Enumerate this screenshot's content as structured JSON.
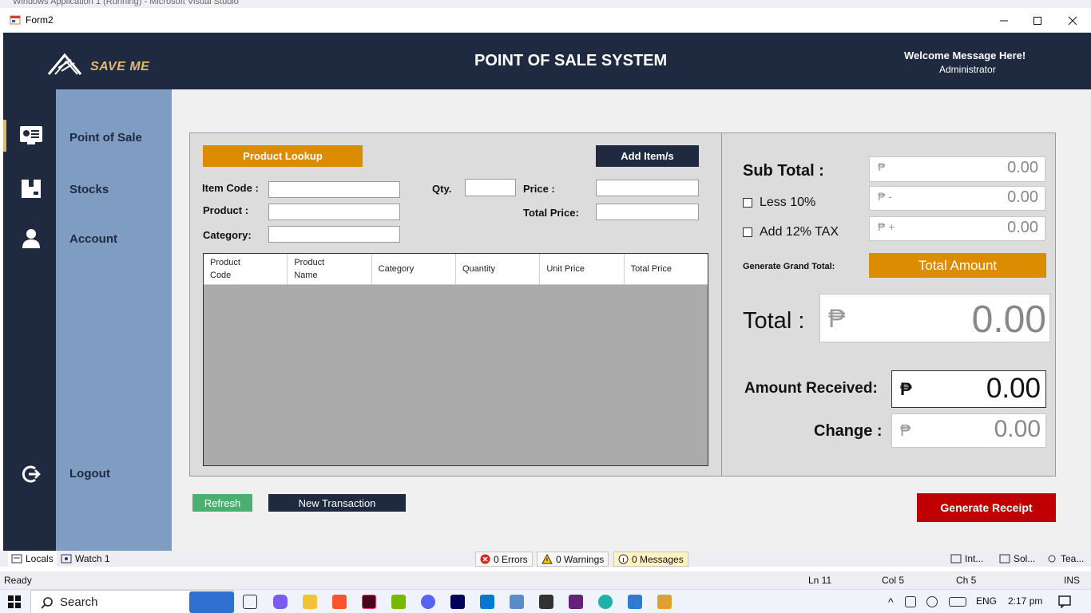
{
  "window": {
    "title": "Form2",
    "background_title": "Windows Application 1 (Running) - Microsoft Visual Studio"
  },
  "header": {
    "logo_text": "SAVE ME",
    "app_title": "POINT OF SALE SYSTEM",
    "welcome": "Welcome Message Here!",
    "role": "Administrator"
  },
  "nav": {
    "items": [
      {
        "label": "Point of Sale",
        "icon": "pos-icon"
      },
      {
        "label": "Stocks",
        "icon": "box-icon"
      },
      {
        "label": "Account",
        "icon": "user-icon"
      }
    ],
    "logout_label": "Logout"
  },
  "pos": {
    "product_lookup": "Product Lookup",
    "add_items": "Add Item/s",
    "item_code_label": "Item Code :",
    "product_label": "Product :",
    "category_label": "Category:",
    "qty_label": "Qty.",
    "price_label": "Price :",
    "total_price_label": "Total Price:",
    "columns": [
      "Product\nCode",
      "Product\nName",
      "Category",
      "Quantity",
      "Unit Price",
      "Total Price"
    ],
    "refresh": "Refresh",
    "new_transaction": "New Transaction",
    "generate_receipt": "Generate Receipt"
  },
  "totals": {
    "subtotal_label": "Sub Total :",
    "subtotal_prefix": "₱",
    "subtotal_value": "0.00",
    "less_label": "Less 10%",
    "less_prefix": "₱ -",
    "less_value": "0.00",
    "tax_label": "Add 12% TAX",
    "tax_prefix": "₱ +",
    "tax_value": "0.00",
    "grand_label": "Generate Grand Total:",
    "total_amount_button": "Total Amount",
    "total_label": "Total :",
    "total_prefix": "₱",
    "total_value": "0.00",
    "received_label": "Amount Received:",
    "received_prefix": "₱",
    "received_value": "0.00",
    "change_label": "Change :",
    "change_prefix": "₱",
    "change_value": "0.00"
  },
  "vs": {
    "locals": "Locals",
    "watch": "Watch 1",
    "errors": "0 Errors",
    "warnings": "0 Warnings",
    "messages": "0 Messages",
    "int": "Int...",
    "sol": "Sol...",
    "tea": "Tea...",
    "ready": "Ready",
    "ln": "Ln 11",
    "col": "Col 5",
    "ch": "Ch 5",
    "ins": "INS"
  },
  "taskbar": {
    "search": "Search",
    "lang": "ENG",
    "time": "2:17 pm"
  },
  "colors": {
    "navy": "#1f2a40",
    "sidebar": "#7f9cc3",
    "orange": "#dc8c00",
    "red": "#c00000",
    "green": "#4caf72",
    "gold": "#e0b870"
  }
}
